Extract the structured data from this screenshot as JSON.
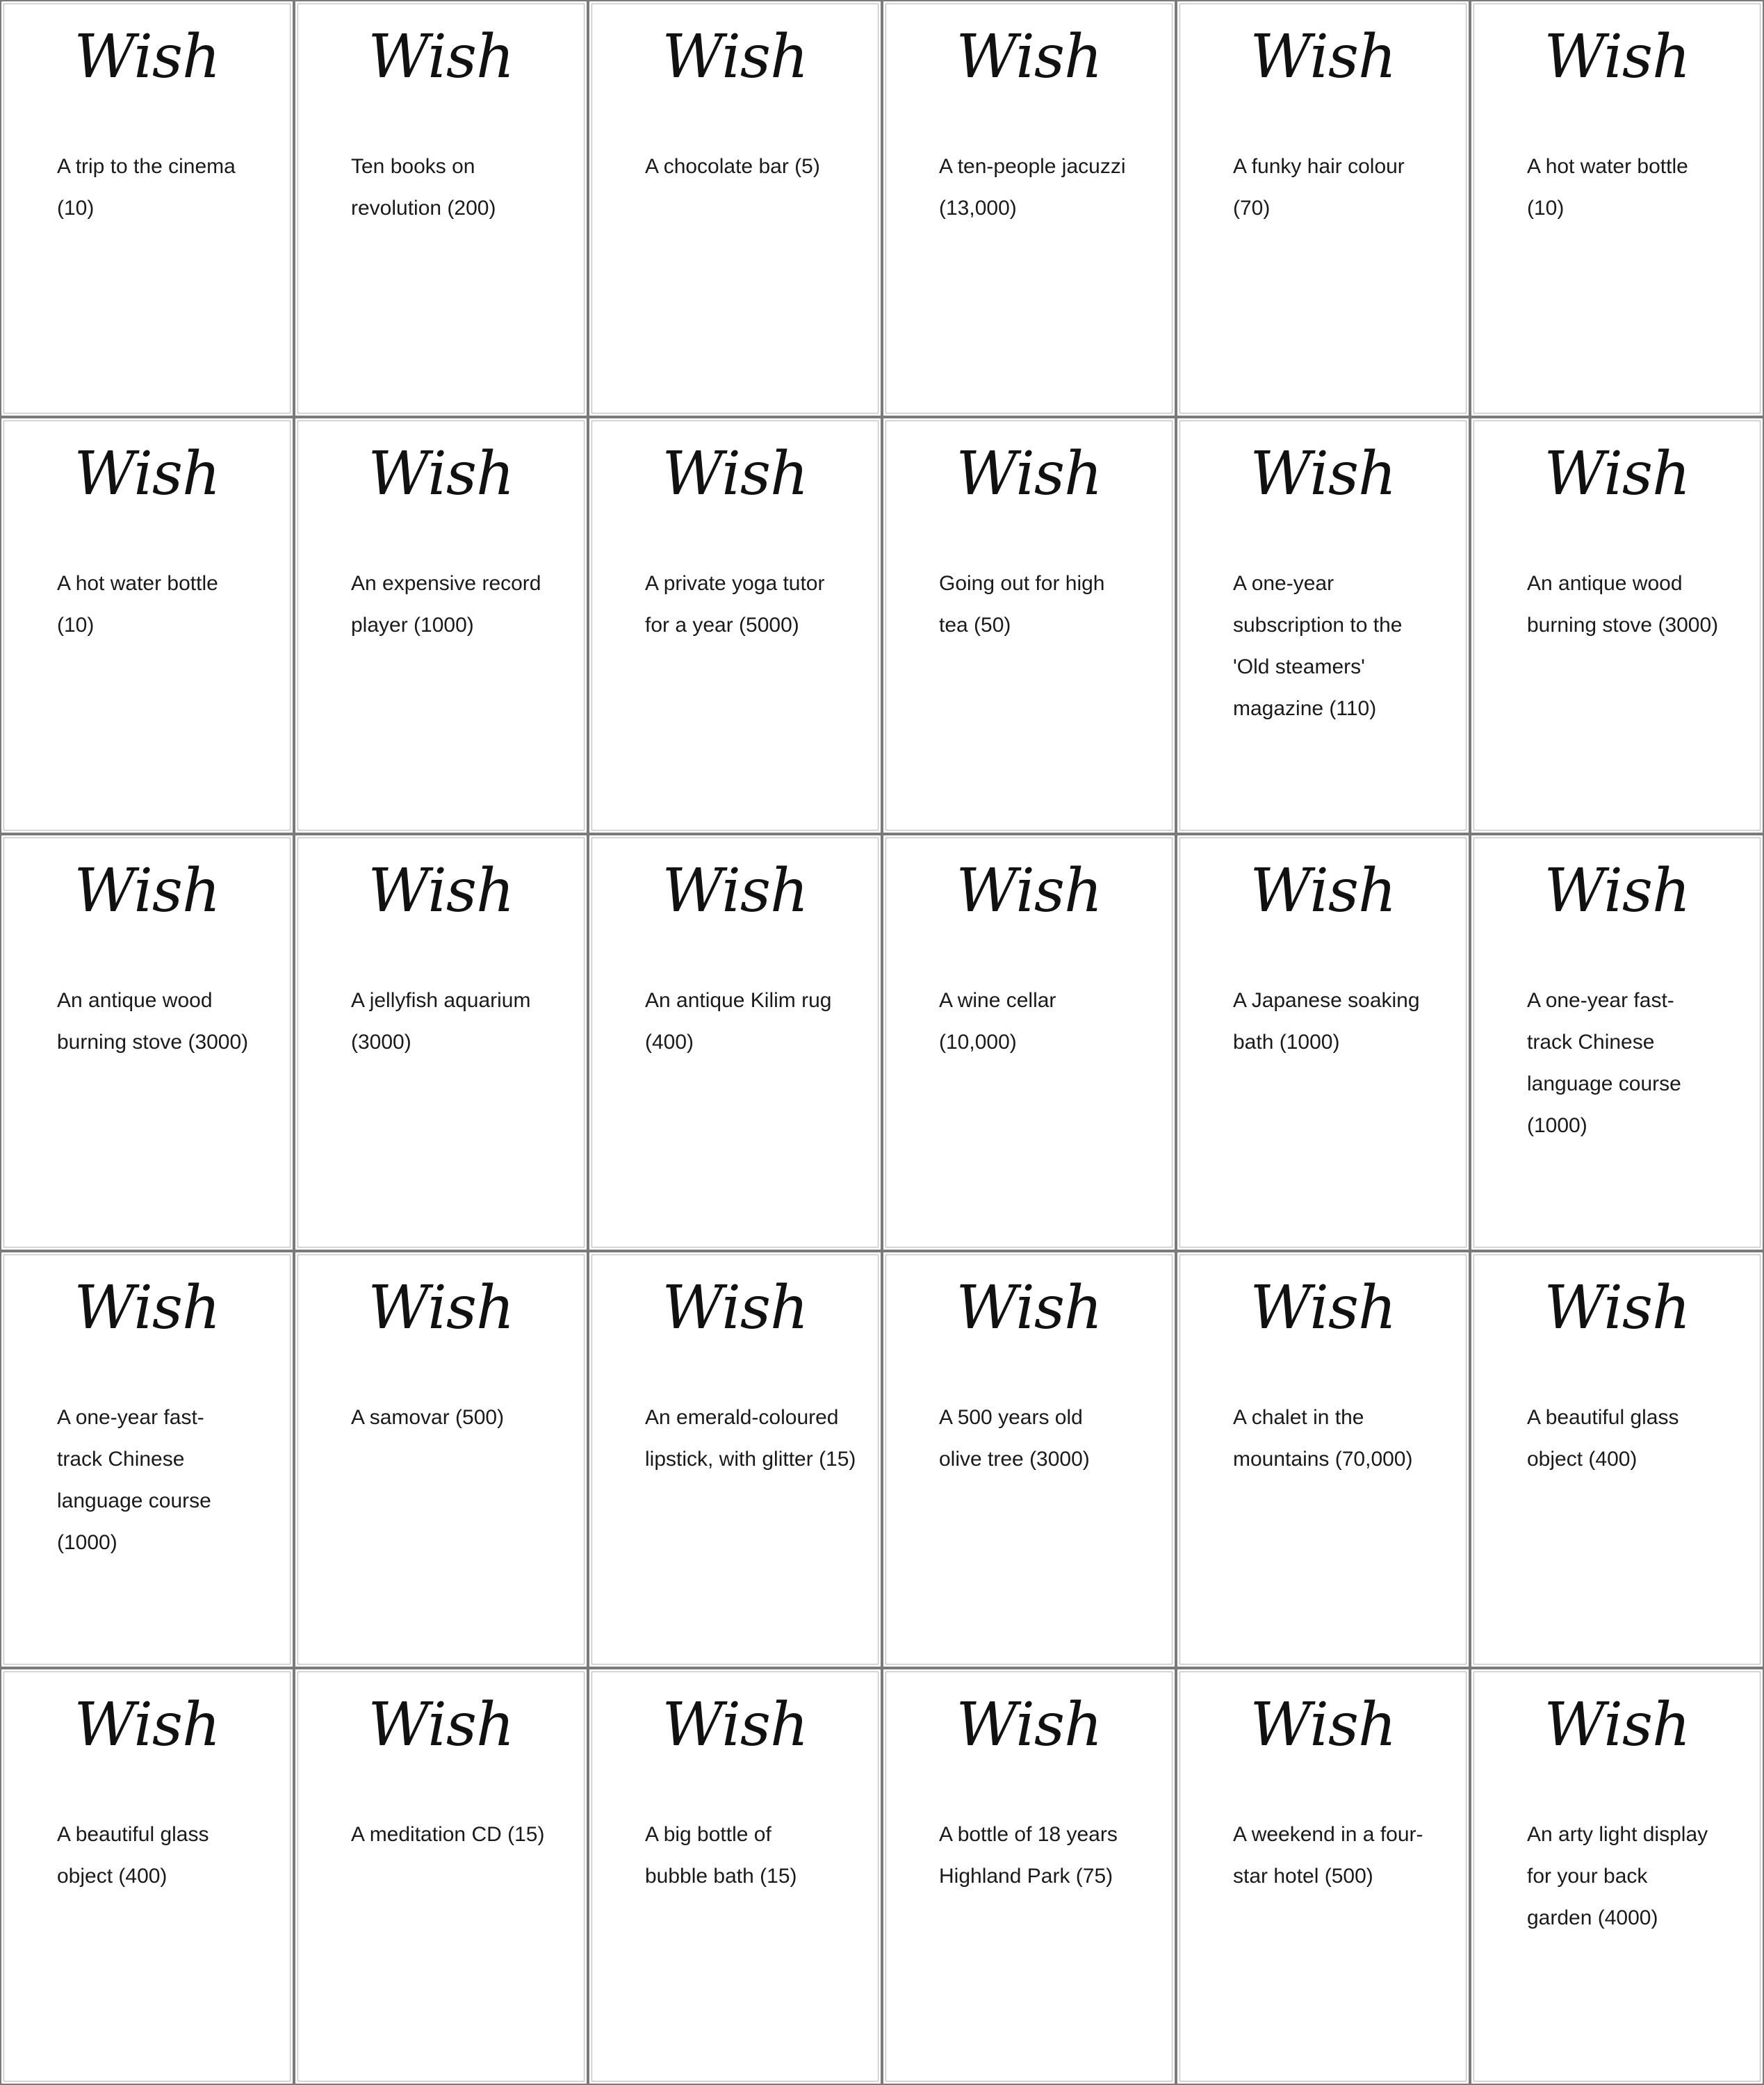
{
  "cards": [
    {
      "title": "Wish",
      "text": "A trip to the cinema (10)"
    },
    {
      "title": "Wish",
      "text": "Ten books on revolution (200)"
    },
    {
      "title": "Wish",
      "text": "A chocolate bar (5)"
    },
    {
      "title": "Wish",
      "text": "A ten-people jacuzzi (13,000)"
    },
    {
      "title": "Wish",
      "text": "A funky hair colour (70)"
    },
    {
      "title": "Wish",
      "text": "A hot water bottle (10)"
    },
    {
      "title": "Wish",
      "text": "A hot water bottle (10)"
    },
    {
      "title": "Wish",
      "text": "An expensive record player (1000)"
    },
    {
      "title": "Wish",
      "text": "A private yoga tutor for a year (5000)"
    },
    {
      "title": "Wish",
      "text": "Going out for high tea (50)"
    },
    {
      "title": "Wish",
      "text": "A one-year subscription to the 'Old steamers' magazine (110)"
    },
    {
      "title": "Wish",
      "text": "An antique wood burning stove (3000)"
    },
    {
      "title": "Wish",
      "text": "An antique wood burning stove (3000)"
    },
    {
      "title": "Wish",
      "text": "A jellyfish aquarium (3000)"
    },
    {
      "title": "Wish",
      "text": "An antique Kilim rug (400)"
    },
    {
      "title": "Wish",
      "text": "A wine cellar (10,000)"
    },
    {
      "title": "Wish",
      "text": "A Japanese soaking bath (1000)"
    },
    {
      "title": "Wish",
      "text": "A one-year fast-track Chinese language course (1000)"
    },
    {
      "title": "Wish",
      "text": "A one-year fast-track Chinese language course (1000)"
    },
    {
      "title": "Wish",
      "text": "A samovar (500)"
    },
    {
      "title": "Wish",
      "text": "An emerald-coloured lipstick, with glitter (15)"
    },
    {
      "title": "Wish",
      "text": "A 500 years old olive tree (3000)"
    },
    {
      "title": "Wish",
      "text": "A chalet in the mountains (70,000)"
    },
    {
      "title": "Wish",
      "text": "A beautiful glass object (400)"
    },
    {
      "title": "Wish",
      "text": "A beautiful glass object (400)"
    },
    {
      "title": "Wish",
      "text": "A meditation CD (15)"
    },
    {
      "title": "Wish",
      "text": "A big bottle of bubble bath (15)"
    },
    {
      "title": "Wish",
      "text": "A bottle of 18 years Highland Park (75)"
    },
    {
      "title": "Wish",
      "text": "A weekend in a four-star hotel (500)"
    },
    {
      "title": "Wish",
      "text": "An arty light display for your back garden (4000)"
    }
  ]
}
